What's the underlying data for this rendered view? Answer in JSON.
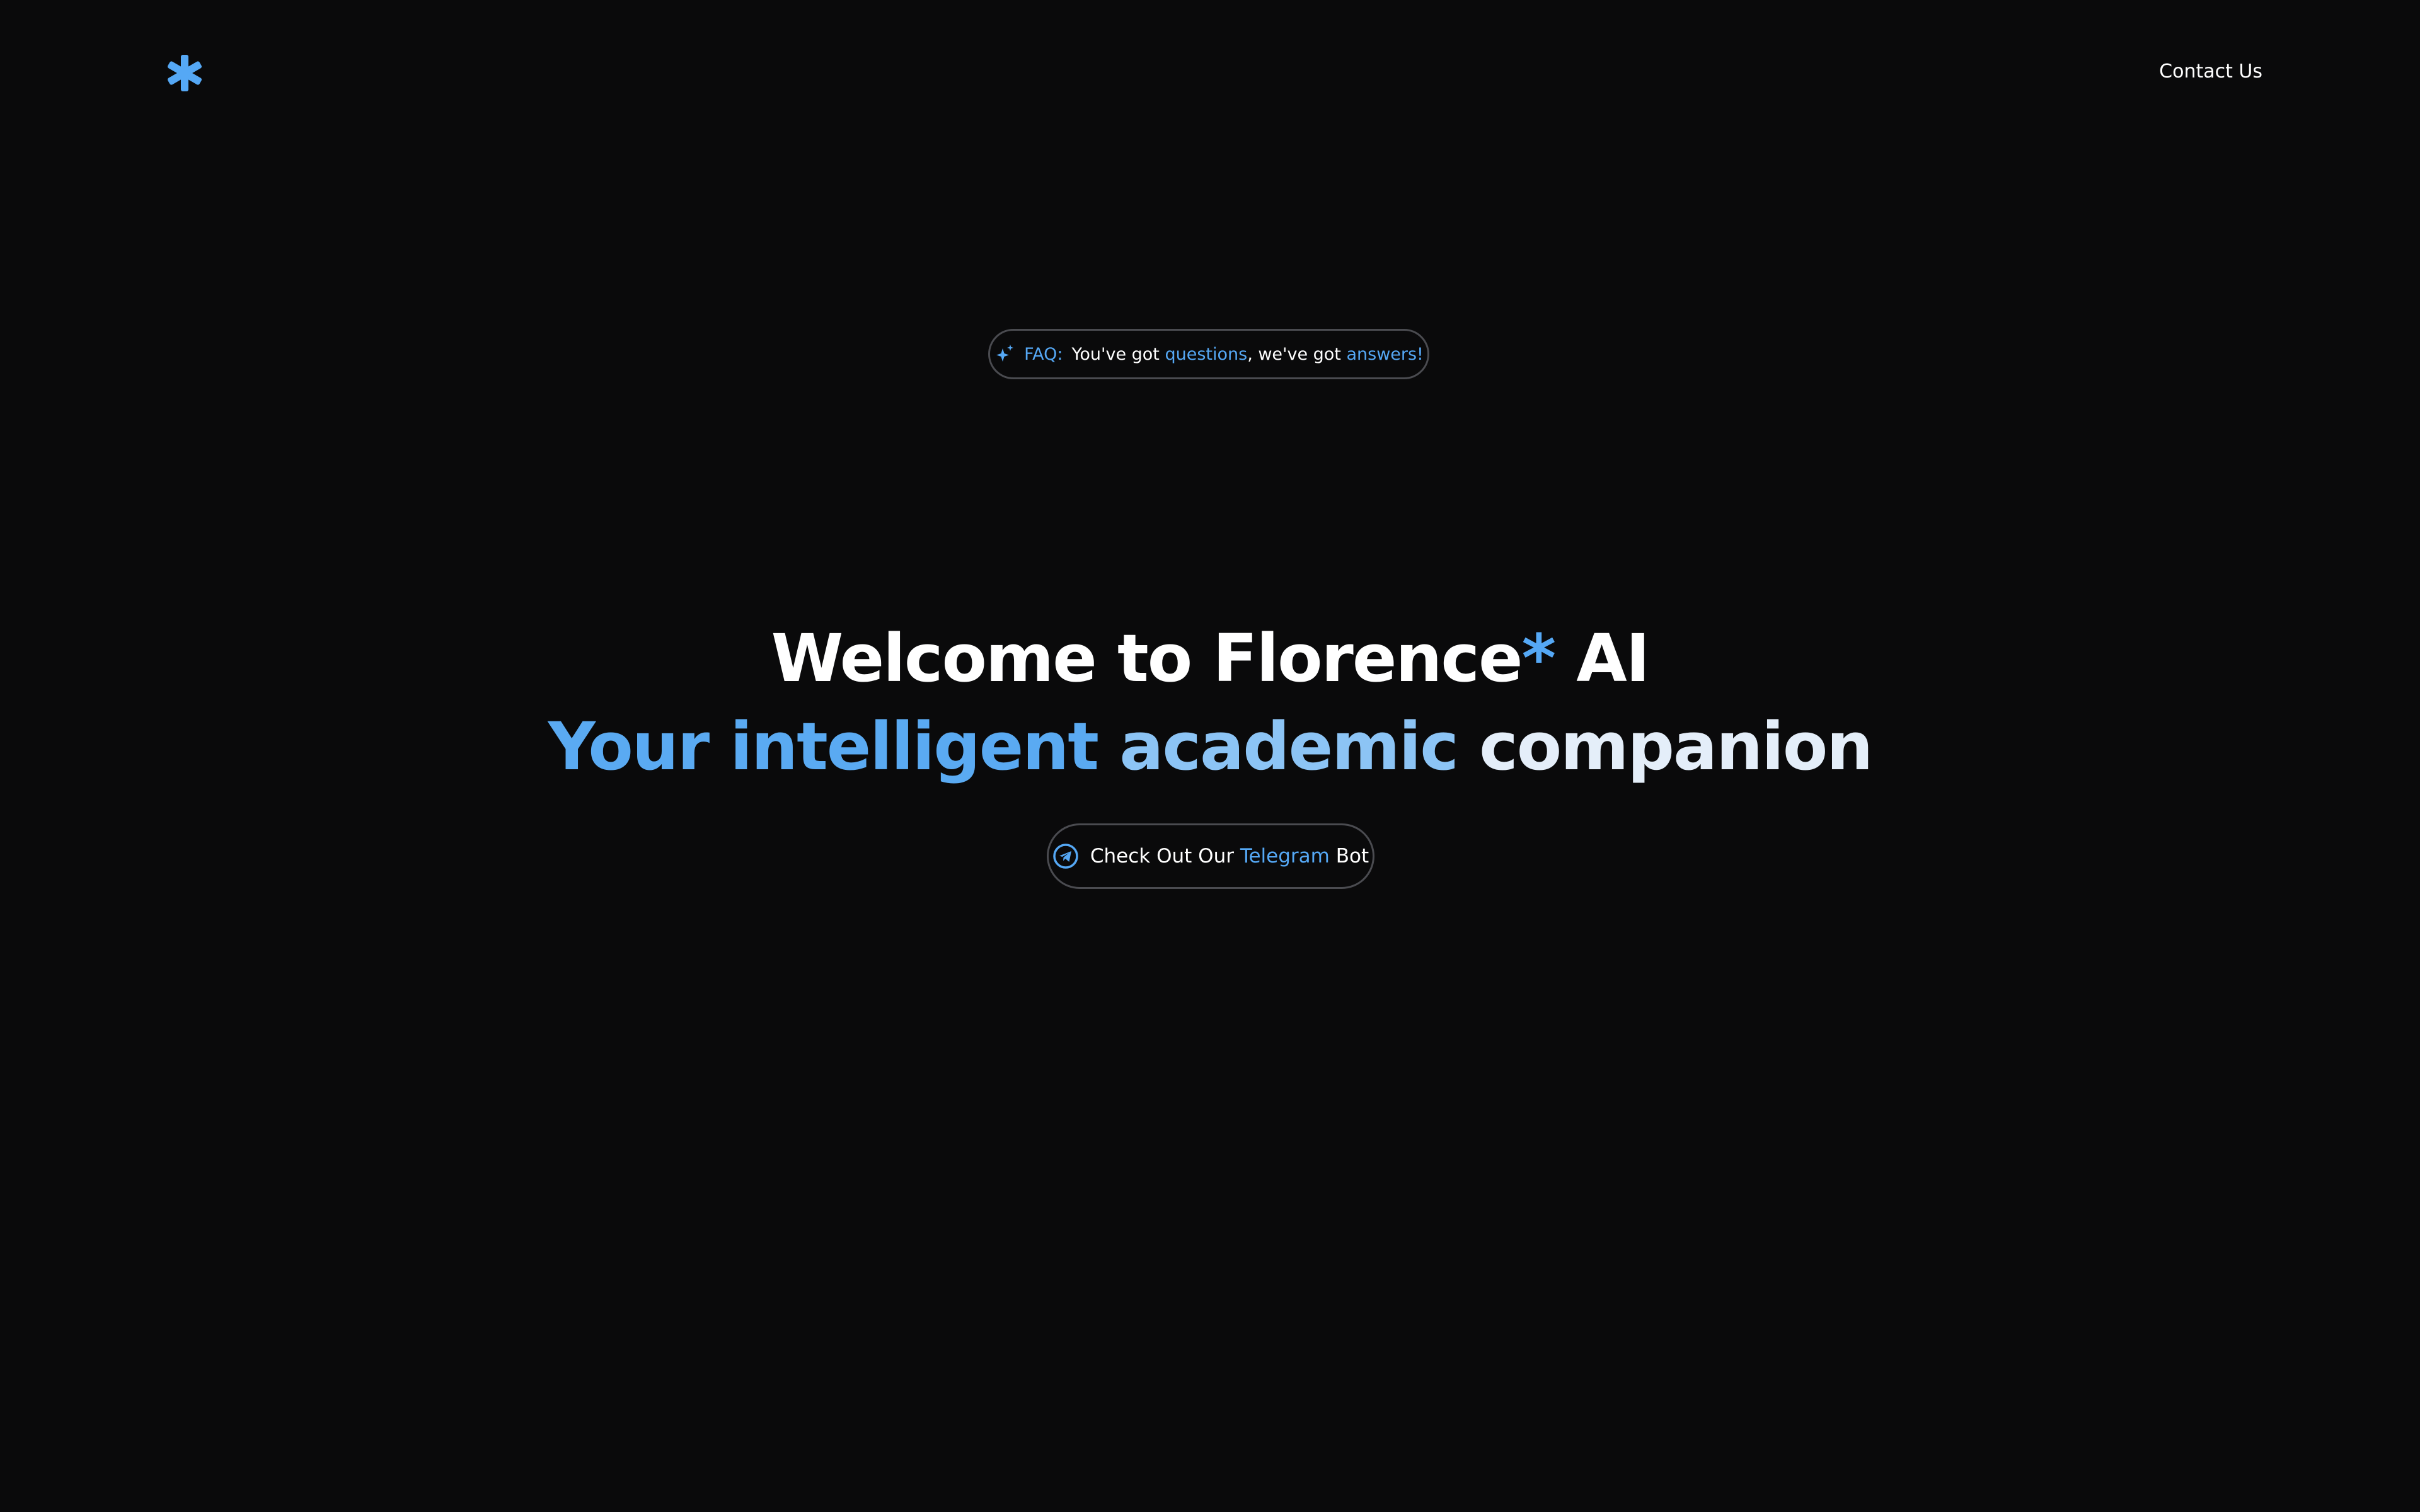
{
  "header": {
    "logo_icon": "asterisk-logo-icon",
    "contact_label": "Contact Us"
  },
  "faq_banner": {
    "icon": "sparkle-icon",
    "label": "FAQ:",
    "text_part1": "You've got ",
    "text_highlight1": "questions",
    "text_part2": ", we've got ",
    "text_highlight2": "answers!"
  },
  "hero": {
    "title_part1": "Welcome to Florence",
    "title_star": "*",
    "title_part2": " AI",
    "subtitle_part1": "Your intelligent ",
    "subtitle_part2": "academic ",
    "subtitle_part3": "companion"
  },
  "cta": {
    "icon": "telegram-icon",
    "label_part1": "Check Out Our ",
    "label_highlight": "Telegram",
    "label_part2": " Bot"
  },
  "colors": {
    "background": "#0a0a0b",
    "accent": "#55a8f5",
    "border": "#4a4b50",
    "text": "#ffffff"
  }
}
